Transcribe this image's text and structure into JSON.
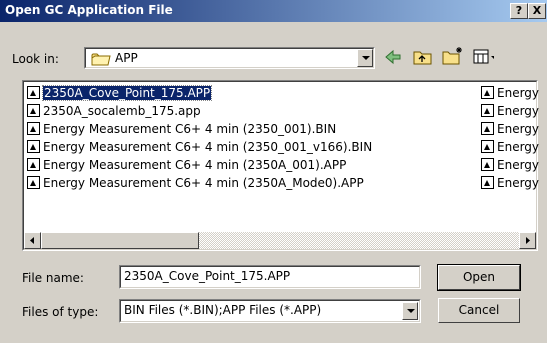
{
  "window": {
    "title": "Open GC Application File",
    "help_label": "?",
    "close_label": "X"
  },
  "look_in": {
    "label": "Look in:",
    "value": "APP"
  },
  "files_left": [
    {
      "name": "2350A_Cove_Point_175.APP",
      "selected": true
    },
    {
      "name": "2350A_socalemb_175.app",
      "selected": false
    },
    {
      "name": "Energy Measurement C6+ 4 min (2350_001).BIN",
      "selected": false
    },
    {
      "name": "Energy Measurement C6+ 4 min (2350_001_v166).BIN",
      "selected": false
    },
    {
      "name": "Energy Measurement C6+ 4 min (2350A_001).APP",
      "selected": false
    },
    {
      "name": "Energy Measurement C6+ 4 min (2350A_Mode0).APP",
      "selected": false
    }
  ],
  "files_right": [
    {
      "name": "Energy"
    },
    {
      "name": "Energy"
    },
    {
      "name": "Energy"
    },
    {
      "name": "Energy"
    },
    {
      "name": "Energy"
    },
    {
      "name": "Energy"
    }
  ],
  "file_name": {
    "label": "File name:",
    "value": "2350A_Cove_Point_175.APP"
  },
  "files_of_type": {
    "label": "Files of type:",
    "value": "BIN Files (*.BIN);APP Files (*.APP)"
  },
  "buttons": {
    "open": "Open",
    "cancel": "Cancel"
  },
  "icons": {
    "folder": "folder-icon",
    "back": "back-arrow-icon",
    "up": "up-folder-icon",
    "new_folder": "new-folder-icon",
    "view": "view-menu-icon",
    "file": "app-file-icon"
  },
  "colors": {
    "titlebar_start": "#0a246a",
    "titlebar_end": "#a6caf0",
    "selection": "#0a246a",
    "face": "#d4d0c8"
  }
}
